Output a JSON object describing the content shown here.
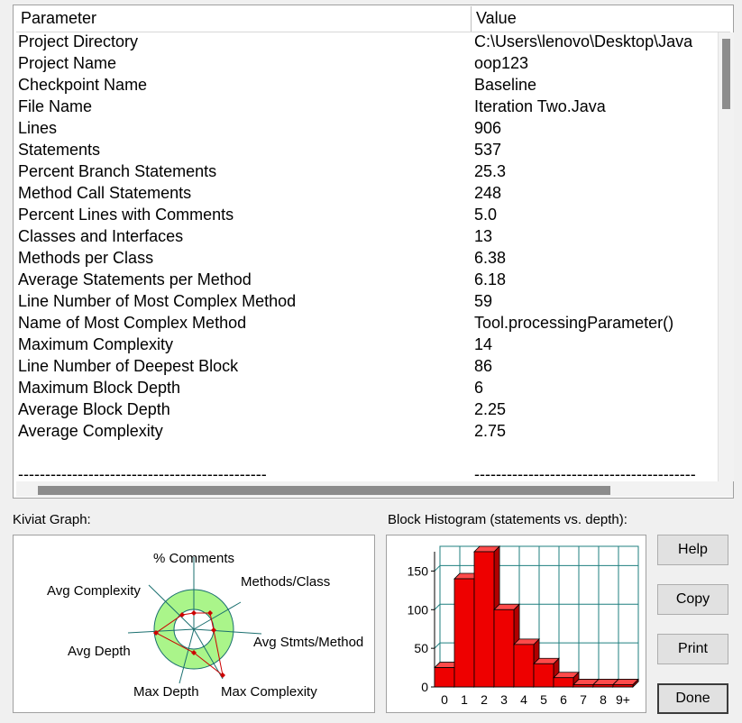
{
  "table": {
    "headers": {
      "parameter": "Parameter",
      "value": "Value"
    },
    "rows": [
      {
        "parameter": "Project Directory",
        "value": "C:\\Users\\lenovo\\Desktop\\Java"
      },
      {
        "parameter": "Project Name",
        "value": "oop123"
      },
      {
        "parameter": "Checkpoint Name",
        "value": "Baseline"
      },
      {
        "parameter": "File Name",
        "value": "Iteration Two.Java"
      },
      {
        "parameter": "Lines",
        "value": "906"
      },
      {
        "parameter": "Statements",
        "value": "537"
      },
      {
        "parameter": "Percent Branch Statements",
        "value": "25.3"
      },
      {
        "parameter": "Method Call Statements",
        "value": "248"
      },
      {
        "parameter": "Percent Lines with Comments",
        "value": "5.0"
      },
      {
        "parameter": "Classes and Interfaces",
        "value": "13"
      },
      {
        "parameter": "Methods per Class",
        "value": "6.38"
      },
      {
        "parameter": "Average Statements per Method",
        "value": "6.18"
      },
      {
        "parameter": "Line Number of Most Complex Method",
        "value": "59"
      },
      {
        "parameter": "Name of Most Complex Method",
        "value": "Tool.processingParameter()"
      },
      {
        "parameter": "Maximum Complexity",
        "value": "14"
      },
      {
        "parameter": "Line Number of Deepest Block",
        "value": "86"
      },
      {
        "parameter": "Maximum Block Depth",
        "value": "6"
      },
      {
        "parameter": "Average Block Depth",
        "value": "2.25"
      },
      {
        "parameter": "Average Complexity",
        "value": "2.75"
      },
      {
        "parameter": "",
        "value": ""
      },
      {
        "parameter": "----------------------------------------------",
        "value": "-----------------------------------------"
      }
    ]
  },
  "kiviat": {
    "label": "Kiviat Graph:",
    "axes": [
      "% Comments",
      "Methods/Class",
      "Avg Stmts/Method",
      "Max Complexity",
      "Max Depth",
      "Avg Depth",
      "Avg Complexity"
    ],
    "colors": {
      "band": "#aaf58a",
      "axis": "#1a6f6f",
      "series": "#cc0000"
    }
  },
  "histogram": {
    "label": "Block Histogram (statements vs. depth):"
  },
  "chart_data": {
    "type": "bar",
    "categories": [
      "0",
      "1",
      "2",
      "3",
      "4",
      "5",
      "6",
      "7",
      "8",
      "9+"
    ],
    "values": [
      25,
      140,
      175,
      100,
      55,
      30,
      12,
      3,
      3,
      3
    ],
    "ylim": [
      0,
      175
    ],
    "yticks": [
      0,
      50,
      100,
      150
    ],
    "grid": true,
    "bar_color": "#ee0000",
    "grid_color": "#1f7f7f"
  },
  "buttons": {
    "help": "Help",
    "copy": "Copy",
    "print": "Print",
    "done": "Done"
  }
}
